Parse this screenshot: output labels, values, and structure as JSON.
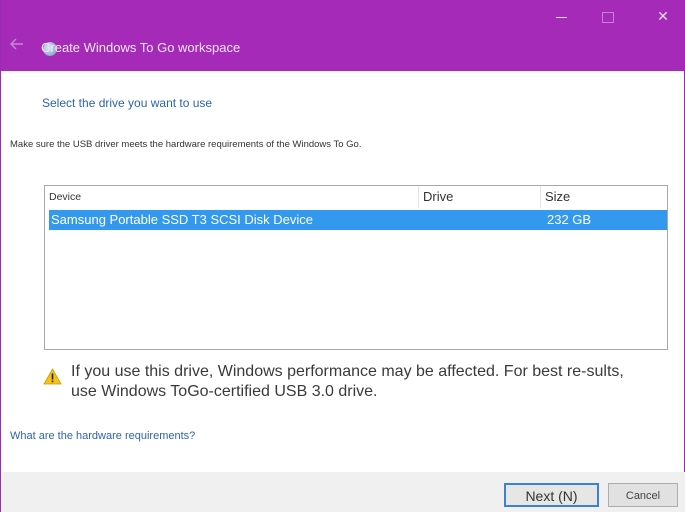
{
  "window": {
    "title": "Create Windows To Go workspace",
    "minimize_icon": "minimize-icon",
    "maximize_icon": "maximize-icon",
    "close_glyph": "✕",
    "back_icon": "back-arrow-icon",
    "accent_color": "#a52ab8"
  },
  "main": {
    "heading": "Select the drive you want to use",
    "subtext": "Make sure the USB driver meets the hardware requirements of the Windows To Go.",
    "columns": [
      "Device",
      "Drive",
      "Size"
    ],
    "rows": [
      {
        "device": "Samsung Portable SSD T3 SCSI Disk Device",
        "drive": "",
        "size": "232 GB"
      }
    ],
    "selection_color": "#3399ee",
    "warning_text": "If you use this drive, Windows performance may be affected. For best re-sults, use Windows ToGo-certified USB 3.0 drive.",
    "warning_icon": "warning-icon",
    "hardware_link": "What are the hardware requirements?"
  },
  "footer": {
    "next_label": "Next (N)",
    "cancel_label": "Cancel"
  }
}
